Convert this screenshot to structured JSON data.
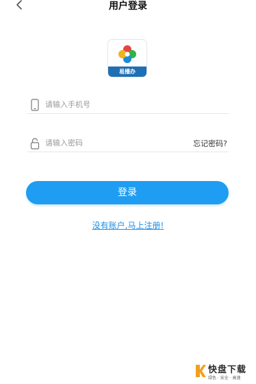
{
  "header": {
    "title": "用户登录",
    "back_icon": "chevron-left-icon"
  },
  "logo": {
    "app_name": "易播办"
  },
  "form": {
    "phone": {
      "placeholder": "请输入手机号",
      "value": "",
      "icon": "phone-icon"
    },
    "password": {
      "placeholder": "请输入密码",
      "value": "",
      "icon": "lock-icon"
    },
    "forgot_label": "忘记密码?",
    "login_label": "登录",
    "register_label": "没有账户,马上注册!"
  },
  "watermark": {
    "text": "快盘下载",
    "sub": "绿色 · 安全 · 高速"
  },
  "colors": {
    "accent": "#1e9df2",
    "link": "#1e8ee6",
    "logo_band": "#1f6fb5"
  }
}
